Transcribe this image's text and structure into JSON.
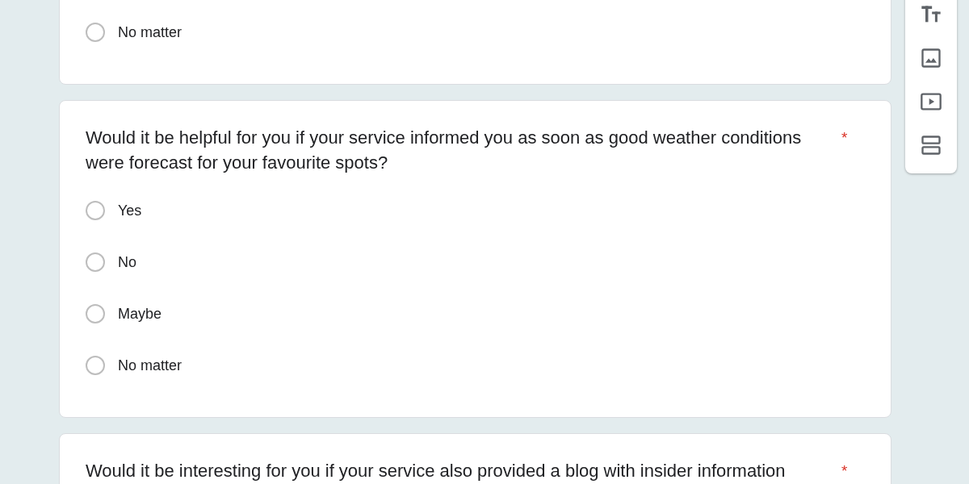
{
  "questions": [
    {
      "options": [
        {
          "label": "No matter",
          "selected": false
        }
      ]
    },
    {
      "title": "Would it be helpful for you if your service informed you as soon as good weather conditions were forecast for your favourite spots?",
      "asterisk": "*",
      "options": [
        {
          "label": "Yes",
          "selected": false
        },
        {
          "label": "No",
          "selected": false
        },
        {
          "label": "Maybe",
          "selected": false
        },
        {
          "label": "No matter",
          "selected": false
        }
      ]
    },
    {
      "title": "Would it be interesting for you if your service also provided a blog with insider information",
      "asterisk": "*"
    }
  ],
  "toolbar": [
    {
      "kind": "title"
    },
    {
      "kind": "image"
    },
    {
      "kind": "video"
    },
    {
      "kind": "section"
    }
  ]
}
